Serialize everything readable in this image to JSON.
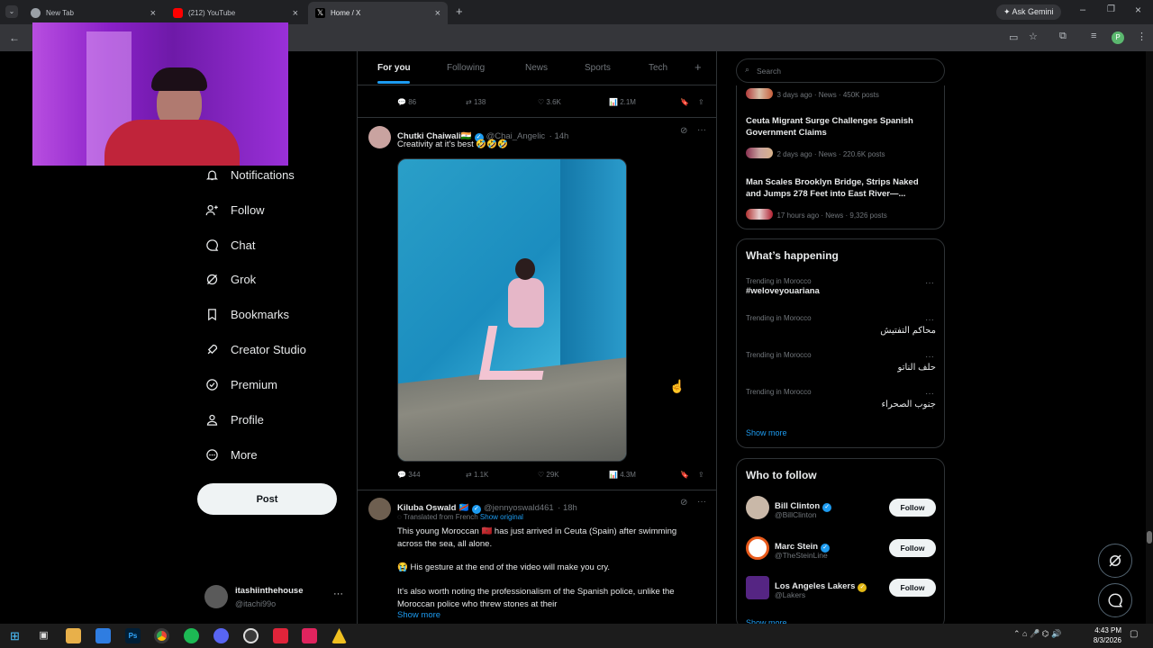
{
  "browser": {
    "tabs": [
      {
        "title": "New Tab"
      },
      {
        "title": "(212) YouTube"
      },
      {
        "title": "Home / X"
      }
    ],
    "gemini_label": "Ask Gemini",
    "profile_initial": "P"
  },
  "nav": {
    "items": [
      {
        "label": "Notifications",
        "icon": "bell-icon"
      },
      {
        "label": "Follow",
        "icon": "person-add-icon"
      },
      {
        "label": "Chat",
        "icon": "chat-icon"
      },
      {
        "label": "Grok",
        "icon": "grok-icon"
      },
      {
        "label": "Bookmarks",
        "icon": "bookmark-icon"
      },
      {
        "label": "Creator Studio",
        "icon": "rocket-icon"
      },
      {
        "label": "Premium",
        "icon": "premium-icon"
      },
      {
        "label": "Profile",
        "icon": "profile-icon"
      },
      {
        "label": "More",
        "icon": "more-circle-icon"
      }
    ],
    "post_label": "Post",
    "account": {
      "name": "itashiinthehouse",
      "handle": "@itachi99o"
    }
  },
  "feed": {
    "tabs": [
      "For you",
      "Following",
      "News",
      "Sports",
      "Tech"
    ],
    "active_tab": "For you",
    "prev_stats": {
      "replies": "86",
      "reposts": "138",
      "likes": "3.6K",
      "views": "2.1M"
    },
    "tweet1": {
      "name": "Chutki Chaiwali🇮🇳",
      "handle": "@Chai_Angelic",
      "time": "· 14h",
      "text": "Creativity at it's best 🤣🤣🤣",
      "stats": {
        "replies": "344",
        "reposts": "1.1K",
        "likes": "29K",
        "views": "4.3M"
      }
    },
    "tweet2": {
      "name": "Kiluba Oswald 🇨🇩",
      "handle": "@jennyoswald461",
      "time": "· 18h",
      "translated": "Translated from French",
      "show_original": "Show original",
      "line1": "This young Moroccan 🇲🇦 has just arrived in Ceuta (Spain) after swimming across the sea, all alone.",
      "line2": "😭 His gesture at the end of the video will make you cry.",
      "line3": "It's also worth noting the professionalism of the Spanish police, unlike the Moroccan police who threw stones at their",
      "show_more": "Show more"
    }
  },
  "sidebar": {
    "search_placeholder": "Search",
    "news": [
      {
        "meta": "3 days ago · News · 450K posts"
      },
      {
        "title": "Ceuta Migrant Surge Challenges Spanish Government Claims",
        "meta": "2 days ago · News · 220.6K posts"
      },
      {
        "title": "Man Scales Brooklyn Bridge, Strips Naked and Jumps 278 Feet into East River—...",
        "meta": "17 hours ago · News · 9,326 posts"
      }
    ],
    "happening_title": "What’s happening",
    "trends": [
      {
        "context": "Trending in Morocco",
        "title": "#weloveyouariana"
      },
      {
        "context": "Trending in Morocco",
        "title": "محاكم التفتيش"
      },
      {
        "context": "Trending in Morocco",
        "title": "حلف الناتو"
      },
      {
        "context": "Trending in Morocco",
        "title": "جنوب الصحراء"
      }
    ],
    "show_more": "Show more",
    "who_title": "Who to follow",
    "follow_label": "Follow",
    "who": [
      {
        "name": "Bill Clinton",
        "handle": "@BillClinton"
      },
      {
        "name": "Marc Stein",
        "handle": "@TheSteinLine"
      },
      {
        "name": "Los Angeles Lakers",
        "handle": "@Lakers"
      }
    ],
    "show_more_2": "Show more"
  },
  "taskbar": {
    "time": "4:43 PM",
    "date": "8/3/2026"
  },
  "colors": {
    "accent": "#1d9bf0",
    "bg": "#000000",
    "webcam": "#a020f0"
  }
}
